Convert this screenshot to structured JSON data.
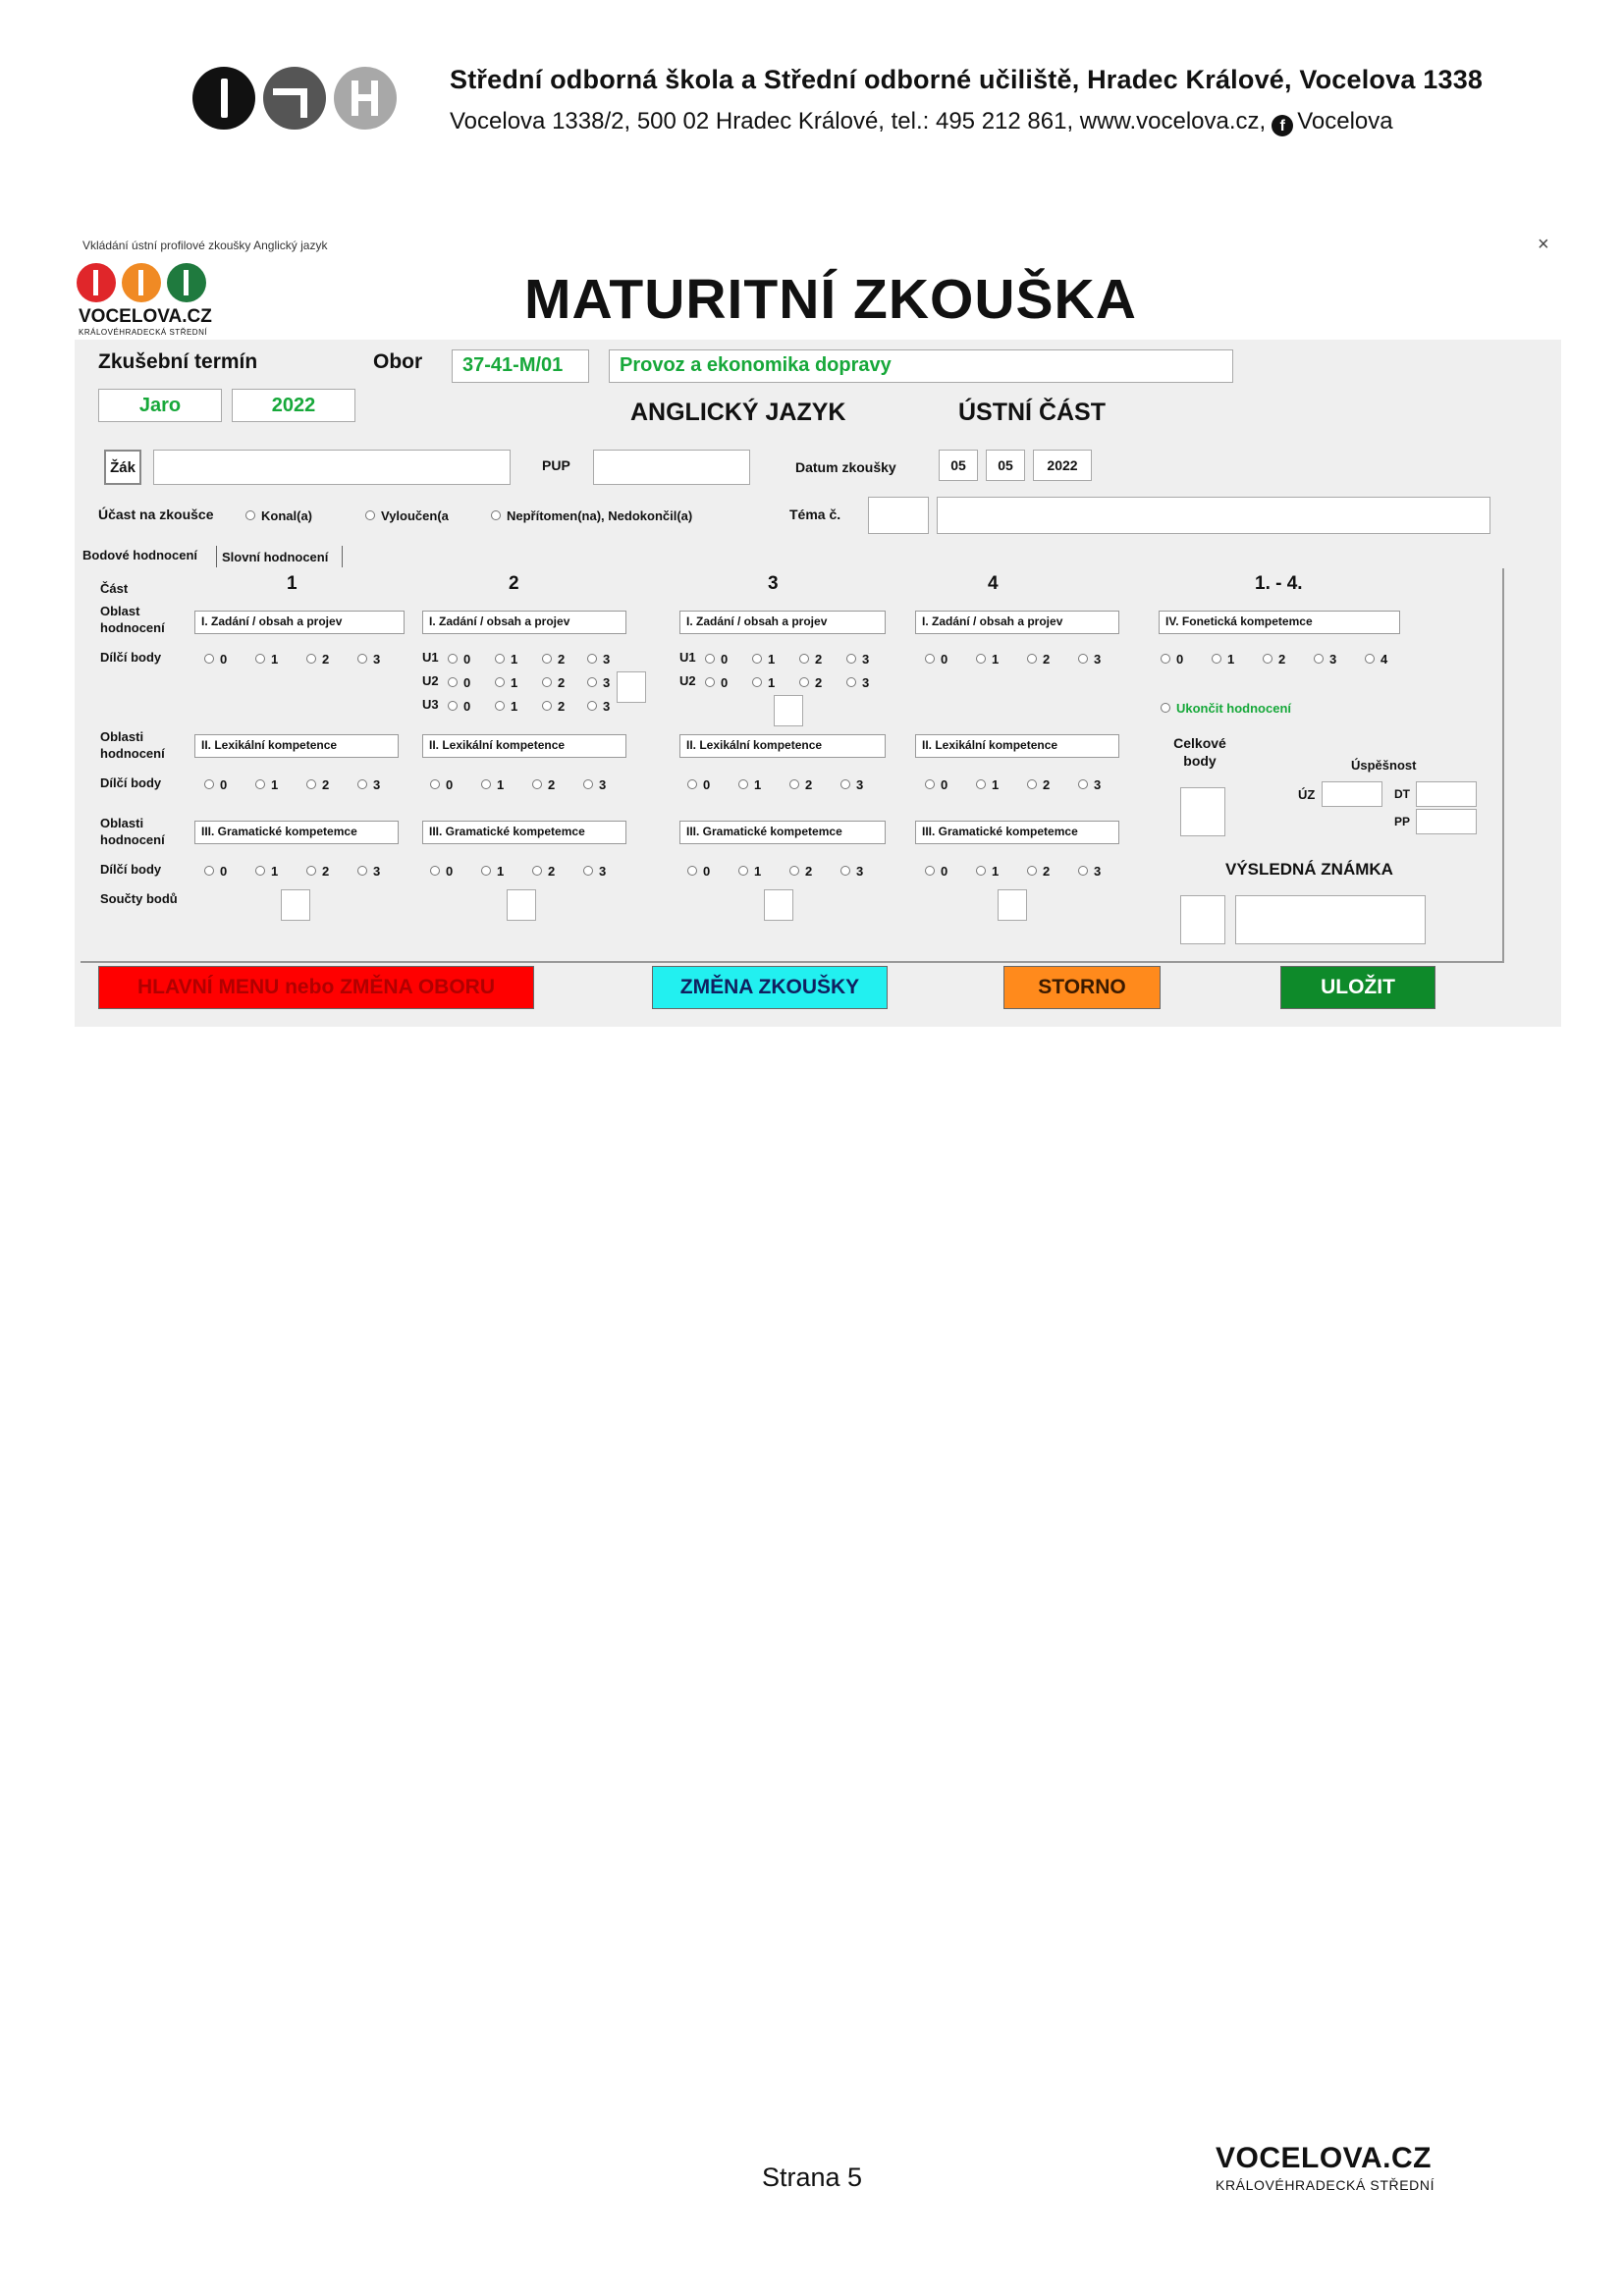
{
  "letterhead": {
    "title": "Střední odborná škola a Střední odborné učiliště, Hradec Králové, Vocelova 1338",
    "address": "Vocelova 1338/2, 500 02 Hradec Králové, tel.: 495 212 861, www.vocelova.cz,",
    "facebook": "Vocelova",
    "facebook_icon": "f"
  },
  "window": {
    "title": "Vkládání ústní profilové zkoušky  Anglický jazyk",
    "close_glyph": "×",
    "logo_text": "VOCELOVA.CZ",
    "logo_sub": "KRÁLOVÉHRADECKÁ STŘEDNÍ",
    "main_title": "MATURITNÍ ZKOUŠKA"
  },
  "form": {
    "term_label": "Zkušební termín",
    "term_season": "Jaro",
    "term_year": "2022",
    "obor_label": "Obor",
    "obor_code": "37-41-M/01",
    "obor_name": "Provoz a ekonomika dopravy",
    "subject": "ANGLICKÝ JAZYK",
    "part": "ÚSTNÍ ČÁST",
    "zak_button": "Žák",
    "zak_value": "",
    "pup_label": "PUP",
    "pup_value": "",
    "datum_label": "Datum zkoušky",
    "date_day": "05",
    "date_month": "05",
    "date_year": "2022",
    "ucast_label": "Účast na zkoušce",
    "ucast_options": [
      "Konal(a)",
      "Vyloučen(a",
      "Nepřítomen(na), Nedokončil(a)"
    ],
    "tema_label": "Téma č.",
    "tema_no": "",
    "tema_text": ""
  },
  "tabs": [
    "Bodové hodnocení",
    "Slovní hodnocení"
  ],
  "grid": {
    "row_labels": {
      "cast": "Část",
      "oblast": "Oblast hodnocení",
      "oblasti": "Oblasti hodnocení",
      "dilci": "Dílčí body",
      "soucty": "Součty bodů"
    },
    "columns": [
      "1",
      "2",
      "3",
      "4",
      "1. - 4."
    ],
    "area1": "I.  Zadání / obsah a projev",
    "area2": "II.  Lexikální kompetence",
    "area3": "III. Gramatické kompetemce",
    "area4": "IV.  Fonetická kompetemce",
    "points": [
      "0",
      "1",
      "2",
      "3"
    ],
    "points4": [
      "0",
      "1",
      "2",
      "3",
      "4"
    ],
    "u_labels": [
      "U1",
      "U2",
      "U3"
    ],
    "ukoncit": "Ukončit hodnocení",
    "celkove": "Celkové body",
    "uspesnost": "Úspěšnost",
    "uz": "ÚZ",
    "dt": "DT",
    "pp": "PP",
    "vysledna": "VÝSLEDNÁ ZNÁMKA"
  },
  "buttons": {
    "menu": "HLAVNÍ MENU nebo  ZMĚNA OBORU",
    "zmena": "ZMĚNA ZKOUŠKY",
    "storno": "STORNO",
    "ulozit": "ULOŽIT"
  },
  "colors": {
    "menu_bg": "#ff0000",
    "menu_fg": "#b00000",
    "zmena_bg": "#22f0f0",
    "storno_bg": "#ff8a1c",
    "ulozit_bg": "#0e8a2a",
    "ok_green": "#17a83a"
  },
  "footer": {
    "page": "Strana 5",
    "brand": "VOCELOVA.CZ",
    "brand_sub": "KRÁLOVÉHRADECKÁ STŘEDNÍ"
  }
}
